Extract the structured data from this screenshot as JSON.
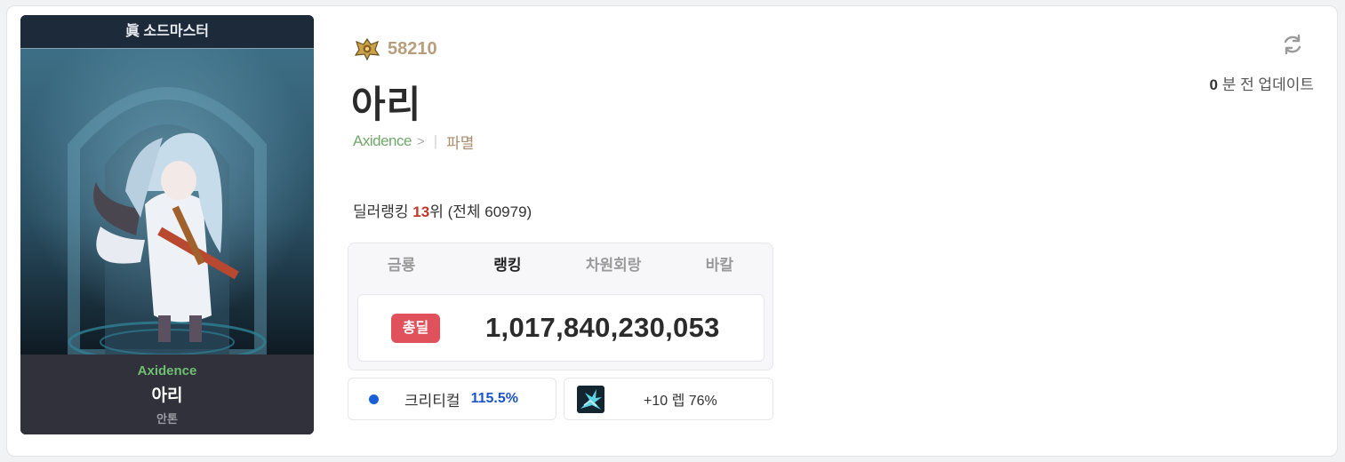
{
  "character": {
    "job_title": "眞 소드마스터",
    "adventure": "Axidence",
    "name": "아리",
    "server": "안톤"
  },
  "profile": {
    "fame_value": "58210",
    "name": "아리",
    "adventure_link": "Axidence",
    "chevron": ">",
    "divider": "|",
    "server": "파멸"
  },
  "ranking": {
    "label": "딜러랭킹",
    "rank": "13",
    "rank_suffix": "위",
    "total_text": "(전체 60979)"
  },
  "tabs": [
    {
      "label": "금룡",
      "active": false
    },
    {
      "label": "랭킹",
      "active": true
    },
    {
      "label": "차원회랑",
      "active": false
    },
    {
      "label": "바칼",
      "active": false
    }
  ],
  "damage": {
    "badge": "총딜",
    "value": "1,017,840,230,053",
    "badge_color": "#e0515c"
  },
  "stats": {
    "crit_label": "크리티컬",
    "crit_value": "115.5%",
    "crit_color": "#1a55c9",
    "buff_text": "+10 렙 76%",
    "buff_icon": "skill-icon"
  },
  "update": {
    "minutes": "0",
    "text": "분 전 업데이트",
    "icon": "refresh-icon"
  },
  "colors": {
    "fame": "#b89e7c",
    "adventure": "#6fa86a",
    "rank_highlight": "#c0392b"
  }
}
